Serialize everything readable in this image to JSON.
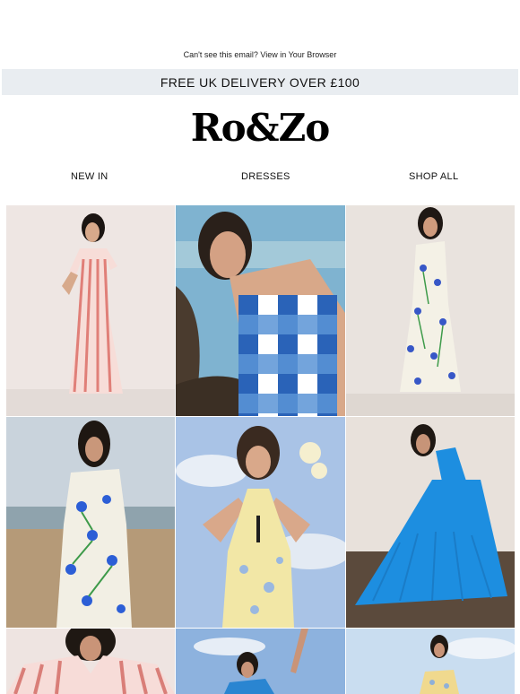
{
  "header": {
    "browser_link": "Can't see this email? View in Your Browser",
    "banner": "FREE UK DELIVERY OVER £100"
  },
  "brand": {
    "logo_text": "Ro&Zo"
  },
  "nav": {
    "items": [
      {
        "label": "NEW IN"
      },
      {
        "label": "DRESSES"
      },
      {
        "label": "SHOP ALL"
      }
    ]
  },
  "products": [
    {
      "name": "pink-striped-dress",
      "colors": [
        "#eee6e3",
        "#e8a29b"
      ]
    },
    {
      "name": "blue-gingham-dress",
      "colors": [
        "#2a63b8",
        "#4a3b2e"
      ]
    },
    {
      "name": "cornflower-print-dress",
      "colors": [
        "#f3f1e8",
        "#3757c7"
      ]
    },
    {
      "name": "floral-one-shoulder-dress",
      "colors": [
        "#f2efe4",
        "#2c5ed6"
      ]
    },
    {
      "name": "yellow-halter-dress",
      "colors": [
        "#f2e7a6",
        "#a9c3e6"
      ]
    },
    {
      "name": "blue-pleated-dress",
      "colors": [
        "#1d8ee0",
        "#5b4a3c"
      ]
    },
    {
      "name": "pink-stripe-shirt-dress",
      "colors": [
        "#f7dcd8",
        "#d97e78"
      ]
    },
    {
      "name": "blue-scarf-look",
      "colors": [
        "#8db2de",
        "#2a85d1"
      ]
    },
    {
      "name": "yellow-print-look",
      "colors": [
        "#c9ddf0",
        "#f0d98e"
      ]
    }
  ]
}
